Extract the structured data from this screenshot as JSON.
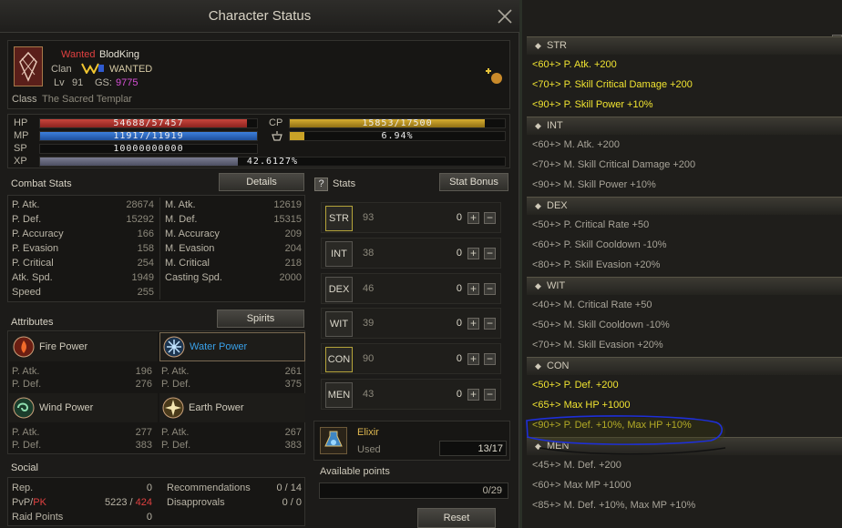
{
  "window": {
    "title": "Character Status"
  },
  "character": {
    "wanted_label": "Wanted",
    "name": "BlodKing",
    "clan_label": "Clan",
    "clan_name": "WANTED",
    "level_label": "Lv",
    "level": "91",
    "gs_label": "GS:",
    "gs": "9775",
    "class_label": "Class",
    "class_name": "The Sacred Templar"
  },
  "vitals": {
    "hp_label": "HP",
    "hp_text": "54688/57457",
    "hp_fraction": 0.952,
    "mp_label": "MP",
    "mp_text": "11917/11919",
    "mp_fraction": 0.9998,
    "sp_label": "SP",
    "sp_text": "10000000000",
    "xp_label": "XP",
    "xp_text": "42.6127%",
    "xp_fraction": 0.426,
    "cp_label": "CP",
    "cp_text": "15853/17500",
    "cp_fraction": 0.906,
    "weight_text": "6.94%",
    "weight_fraction": 0.0694
  },
  "combat": {
    "title": "Combat Stats",
    "details_button": "Details",
    "left": [
      {
        "label": "P. Atk.",
        "value": "28674"
      },
      {
        "label": "P. Def.",
        "value": "15292"
      },
      {
        "label": "P. Accuracy",
        "value": "166"
      },
      {
        "label": "P. Evasion",
        "value": "158"
      },
      {
        "label": "P. Critical",
        "value": "254"
      },
      {
        "label": "Atk. Spd.",
        "value": "1949"
      },
      {
        "label": "Speed",
        "value": "255"
      }
    ],
    "right": [
      {
        "label": "M. Atk.",
        "value": "12619"
      },
      {
        "label": "M. Def.",
        "value": "15315"
      },
      {
        "label": "M. Accuracy",
        "value": "209"
      },
      {
        "label": "M. Evasion",
        "value": "204"
      },
      {
        "label": "M. Critical",
        "value": "218"
      },
      {
        "label": "Casting Spd.",
        "value": "2000"
      }
    ]
  },
  "attributes": {
    "title": "Attributes",
    "spirits_button": "Spirits",
    "items": [
      {
        "name": "Fire Power",
        "patk_label": "P. Atk.",
        "patk": "196",
        "pdef_label": "P. Def.",
        "pdef": "276"
      },
      {
        "name": "Water Power",
        "patk_label": "P. Atk.",
        "patk": "261",
        "pdef_label": "P. Def.",
        "pdef": "375"
      },
      {
        "name": "Wind Power",
        "patk_label": "P. Atk.",
        "patk": "277",
        "pdef_label": "P. Def.",
        "pdef": "383"
      },
      {
        "name": "Earth Power",
        "patk_label": "P. Atk.",
        "patk": "267",
        "pdef_label": "P. Def.",
        "pdef": "383"
      }
    ]
  },
  "social": {
    "title": "Social",
    "rep_label": "Rep.",
    "rep": "0",
    "pvp_label": "PvP/",
    "pk_label": "PK",
    "pvp": "5223",
    "pk": "424",
    "slash": " / ",
    "raid_label": "Raid Points",
    "raid": "0",
    "rec_label": "Recommendations",
    "rec": "0 / 14",
    "dis_label": "Disapprovals",
    "dis": "0 / 0"
  },
  "stats": {
    "help_icon": "?",
    "title": "Stats",
    "bonus_button": "Stat Bonus",
    "rows": [
      {
        "name": "STR",
        "value": "93",
        "added": "0"
      },
      {
        "name": "INT",
        "value": "38",
        "added": "0"
      },
      {
        "name": "DEX",
        "value": "46",
        "added": "0"
      },
      {
        "name": "WIT",
        "value": "39",
        "added": "0"
      },
      {
        "name": "CON",
        "value": "90",
        "added": "0"
      },
      {
        "name": "MEN",
        "value": "43",
        "added": "0"
      }
    ],
    "plus": "+",
    "minus": "−"
  },
  "elixir": {
    "name": "Elixir",
    "used_label": "Used",
    "used": "13/17"
  },
  "points": {
    "label": "Available points",
    "value": "0/29",
    "reset_button": "Reset"
  },
  "bonuses": {
    "sections": [
      {
        "title": "STR",
        "lines": [
          {
            "text": "<60+> P. Atk. +200",
            "active": true
          },
          {
            "text": "<70+> P. Skill Critical Damage +200",
            "active": true
          },
          {
            "text": "<90+> P. Skill Power +10%",
            "active": true
          }
        ]
      },
      {
        "title": "INT",
        "lines": [
          {
            "text": "<60+> M. Atk. +200",
            "active": false
          },
          {
            "text": "<70+> M. Skill Critical Damage +200",
            "active": false
          },
          {
            "text": "<90+> M. Skill Power +10%",
            "active": false
          }
        ]
      },
      {
        "title": "DEX",
        "lines": [
          {
            "text": "<50+> P. Critical Rate +50",
            "active": false
          },
          {
            "text": "<60+> P. Skill Cooldown -10%",
            "active": false
          },
          {
            "text": "<80+> P. Skill Evasion +20%",
            "active": false
          }
        ]
      },
      {
        "title": "WIT",
        "lines": [
          {
            "text": "<40+> M. Critical Rate +50",
            "active": false
          },
          {
            "text": "<50+> M. Skill Cooldown -10%",
            "active": false
          },
          {
            "text": "<70+> M. Skill Evasion +20%",
            "active": false
          }
        ]
      },
      {
        "title": "CON",
        "lines": [
          {
            "text": "<50+> P. Def. +200",
            "active": true
          },
          {
            "text": "<65+> Max HP +1000",
            "active": true
          },
          {
            "text": "<90+> P. Def. +10%, Max HP +10%",
            "active": true
          }
        ]
      },
      {
        "title": "MEN",
        "lines": [
          {
            "text": "<45+> M. Def. +200",
            "active": false
          },
          {
            "text": "<60+> Max MP +1000",
            "active": false
          },
          {
            "text": "<85+> M. Def. +10%, Max MP +10%",
            "active": false
          }
        ]
      }
    ]
  },
  "colors": {
    "active_bonus": "#f1e431",
    "inactive_bonus": "#a7a398",
    "hp": "#b3312c",
    "mp": "#2e6bc4",
    "cp": "#c9a227",
    "water": "#39a0e8",
    "wanted": "#e04040",
    "gs": "#d64fd6"
  }
}
